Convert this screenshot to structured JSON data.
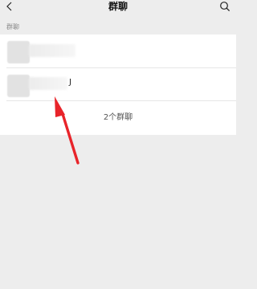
{
  "nav": {
    "title": "群聊",
    "back_icon": "chevron-left-icon",
    "search_icon": "search-icon"
  },
  "section": {
    "header": "群聊"
  },
  "groups": [
    {
      "name_visible_fragment": ""
    },
    {
      "name_visible_fragment": "J"
    }
  ],
  "footer": {
    "count_text": "2个群聊"
  },
  "annotation": {
    "color": "#e8242a"
  }
}
